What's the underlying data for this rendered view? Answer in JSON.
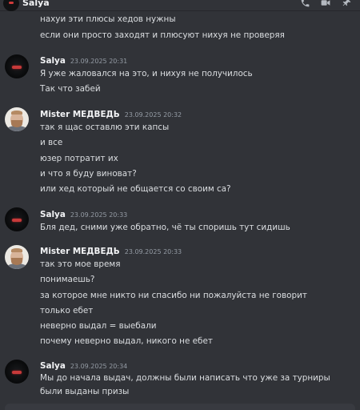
{
  "channel": {
    "title": "Salya"
  },
  "header_icons": [
    "phone-call-icon",
    "video-call-icon",
    "pin-icon"
  ],
  "messages": [
    {
      "author": null,
      "timestamp": null,
      "lines": [
        "нахуи эти плюсы хедов нужны",
        "если они просто заходят и плюсуют нихуя не проверяя"
      ]
    },
    {
      "author": "Salya",
      "timestamp": "23.09.2025 20:31",
      "lines": [
        "Я уже жаловался на это, и нихуя не получилось",
        "Так что забей"
      ]
    },
    {
      "author": "Mister МЕДВЕДЬ",
      "timestamp": "23.09.2025 20:32",
      "lines": [
        "так я щас оставлю эти капсы",
        "и все",
        "юзер потратит их",
        "и что я буду виноват?",
        "или хед который не общается со своим са?"
      ]
    },
    {
      "author": "Salya",
      "timestamp": "23.09.2025 20:33",
      "lines": [
        "Бля дед, сними уже обратно, чё ты споришь тут сидишь"
      ]
    },
    {
      "author": "Mister МЕДВЕДЬ",
      "timestamp": "23.09.2025 20:33",
      "lines": [
        "так это мое время",
        "понимаешь?",
        "за которое мне никто ни спасибо ни пожалуйста не говорит",
        "только ебет",
        "неверно выдал = выебали",
        "почему неверно выдал, никого не ебет"
      ]
    },
    {
      "author": "Salya",
      "timestamp": "23.09.2025 20:34",
      "lines": [
        "Мы до начала выдач, должны были написать что уже за турниры были выданы призы"
      ]
    }
  ]
}
